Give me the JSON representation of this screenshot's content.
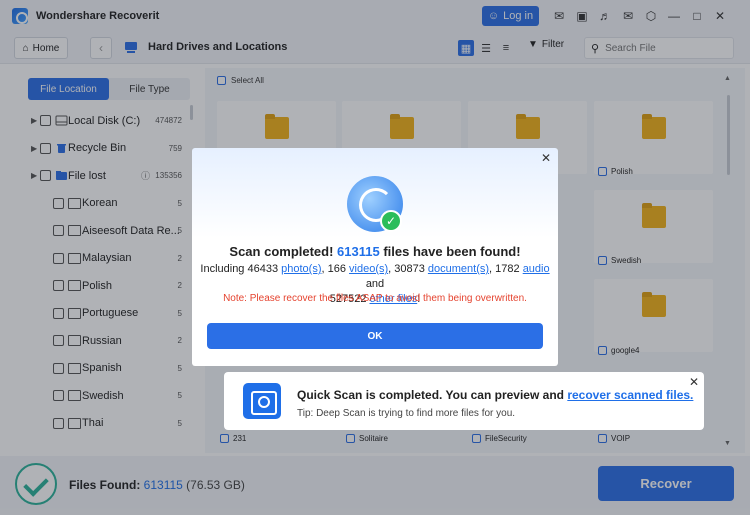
{
  "app": {
    "title": "Wondershare Recoverit"
  },
  "titlebar": {
    "login_label": "Log in",
    "icons": [
      "mail-icon",
      "save-icon",
      "headset-icon",
      "message-icon",
      "box-icon",
      "minimize-icon",
      "maximize-icon",
      "close-icon"
    ]
  },
  "nav": {
    "home_label": "Home",
    "location_title": "Hard Drives and Locations",
    "filter_label": "Filter",
    "search_placeholder": "Search File"
  },
  "sidebar": {
    "tabs": [
      "File Location",
      "File Type"
    ],
    "items": [
      {
        "label": "Local Disk (C:)",
        "count": "474872"
      },
      {
        "label": "Recycle Bin",
        "count": "759"
      },
      {
        "label": "File lost",
        "count": "135356"
      },
      {
        "label": "Korean",
        "count": "5"
      },
      {
        "label": "Aiseesoft Data Re...",
        "count": "5"
      },
      {
        "label": "Malaysian",
        "count": "2"
      },
      {
        "label": "Polish",
        "count": "2"
      },
      {
        "label": "Portuguese",
        "count": "5"
      },
      {
        "label": "Russian",
        "count": "2"
      },
      {
        "label": "Spanish",
        "count": "5"
      },
      {
        "label": "Swedish",
        "count": "5"
      },
      {
        "label": "Thai",
        "count": "5"
      }
    ]
  },
  "content": {
    "select_all_label": "Select All",
    "tile_labels": [
      "Polish",
      "Swedish",
      "google4",
      "231",
      "Solitaire",
      "FileSecurity",
      "VOIP"
    ]
  },
  "toast": {
    "title_prefix": "Quick Scan is completed. You can preview and ",
    "title_link": "recover scanned files.",
    "tip": "Tip: Deep Scan is trying to find more files for you."
  },
  "modal": {
    "heading_prefix": "Scan completed! ",
    "heading_count": "613115",
    "heading_suffix": " files have been found!",
    "body": {
      "t1": "Including 46433 ",
      "photo": "photo(s)",
      "t2": ", 166 ",
      "video": "video(s)",
      "t3": ", 30873 ",
      "document": "document(s)",
      "t4": ", 1782 ",
      "audio": "audio",
      "t5": " and",
      "t6": "527522 ",
      "other": "other files",
      "t7": "!"
    },
    "note": "Note: Please recover the files ASAP to avoid them being overwritten.",
    "ok_label": "OK"
  },
  "bottom": {
    "found_label": "Files Found: ",
    "found_count": "613115",
    "found_size": " (76.53 GB)",
    "recover_label": "Recover"
  },
  "colors": {
    "accent": "#2b6fe6",
    "warning": "#e5432f",
    "success": "#2bbd5b"
  }
}
